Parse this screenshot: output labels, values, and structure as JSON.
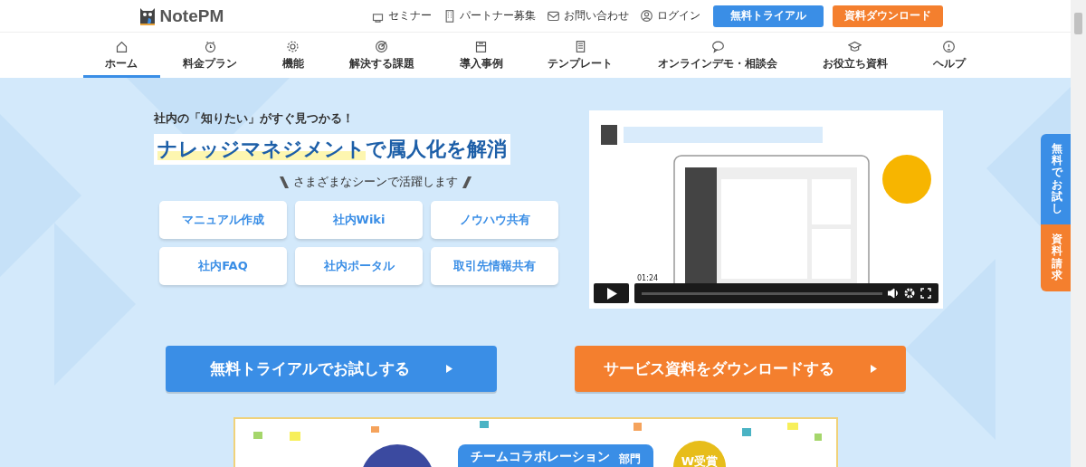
{
  "header": {
    "logo": "NotePM",
    "links": [
      {
        "label": "セミナー"
      },
      {
        "label": "パートナー募集"
      },
      {
        "label": "お問い合わせ"
      },
      {
        "label": "ログイン"
      }
    ],
    "buttons": [
      {
        "label": "無料トライアル",
        "kind": "primary"
      },
      {
        "label": "資料ダウンロード",
        "kind": "secondary"
      }
    ]
  },
  "nav": [
    {
      "label": "ホーム",
      "selected": true
    },
    {
      "label": "料金プラン",
      "selected": false
    },
    {
      "label": "機能",
      "selected": false
    },
    {
      "label": "解決する課題",
      "selected": false
    },
    {
      "label": "導入事例",
      "selected": false
    },
    {
      "label": "テンプレート",
      "selected": false
    },
    {
      "label": "オンラインデモ・相談会",
      "selected": false
    },
    {
      "label": "お役立ち資料",
      "selected": false
    },
    {
      "label": "ヘルプ",
      "selected": false
    }
  ],
  "hero": {
    "tagline": "社内の「知りたい」がすぐ見つかる！",
    "headline": {
      "highlighted": "ナレッジマネジメント",
      "rest": "で属人化を解消"
    },
    "scenes_title": "さまざまなシーンで活躍します",
    "scenes": [
      "マニュアル作成",
      "社内Wiki",
      "ノウハウ共有",
      "社内FAQ",
      "社内ポータル",
      "取引先情報共有"
    ],
    "video": {
      "time": "01:24"
    }
  },
  "cta": [
    {
      "label": "無料トライアルでお試しする",
      "kind": "primary"
    },
    {
      "label": "サービス資料をダウンロードする",
      "kind": "secondary"
    }
  ],
  "side_tabs": [
    {
      "label": "無料でお試し",
      "kind": "primary"
    },
    {
      "label": "資料請求",
      "kind": "secondary"
    }
  ],
  "banner": {
    "ribbon": "チームコラボレーション",
    "category": "部門",
    "award": "W受賞"
  }
}
